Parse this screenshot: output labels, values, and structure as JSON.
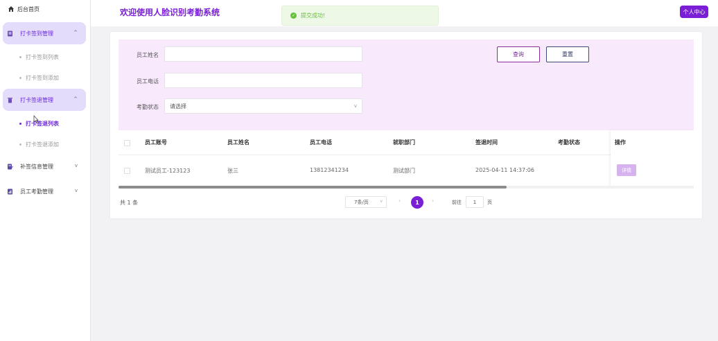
{
  "sidebar": {
    "home": "后台首页",
    "groups": [
      {
        "label": "打卡签到管理",
        "children": [
          "打卡签到列表",
          "打卡签到添加"
        ]
      },
      {
        "label": "打卡签退管理",
        "children": [
          "打卡签退列表",
          "打卡签退添加"
        ]
      }
    ],
    "others": [
      "补签信息管理",
      "员工考勤管理"
    ]
  },
  "header": {
    "title": "欢迎使用人脸识别考勤系统",
    "toast": "提交成功!",
    "user_button": "个人中心"
  },
  "search": {
    "name_label": "员工姓名",
    "name_value": "",
    "phone_label": "员工电话",
    "phone_value": "",
    "status_label": "考勤状态",
    "status_placeholder": "请选择",
    "query_button": "查询",
    "reset_button": "重置"
  },
  "table": {
    "columns": [
      "员工账号",
      "员工姓名",
      "员工电话",
      "就职部门",
      "签退时间",
      "考勤状态",
      "操作"
    ],
    "rows": [
      {
        "account": "测试员工-123123",
        "name": "张三",
        "phone": "13812341234",
        "dept": "测试部门",
        "time": "2025-04-11 14:37:06",
        "status": "",
        "action": "详情"
      }
    ]
  },
  "pagination": {
    "total": "共 1 条",
    "page_size": "7条/页",
    "current": "1",
    "goto_prefix": "前往",
    "goto_value": "1",
    "goto_suffix": "页"
  },
  "colors": {
    "primary": "#7a1fd6",
    "panel": "#f8e9fd",
    "success": "#67c23a"
  }
}
